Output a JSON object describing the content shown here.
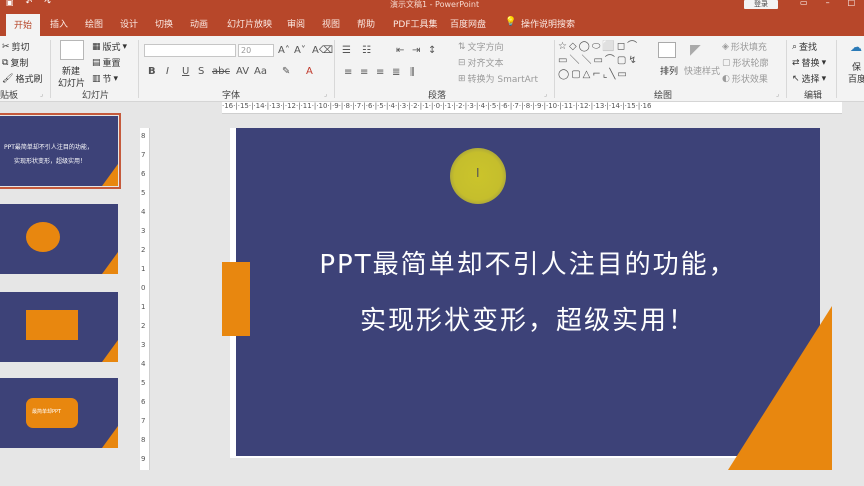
{
  "window": {
    "title": "演示文稿1  -  PowerPoint",
    "login": "登录"
  },
  "tabs": [
    {
      "label": "开始",
      "active": true
    },
    {
      "label": "插入"
    },
    {
      "label": "绘图"
    },
    {
      "label": "设计"
    },
    {
      "label": "切换"
    },
    {
      "label": "动画"
    },
    {
      "label": "幻灯片放映"
    },
    {
      "label": "审阅"
    },
    {
      "label": "视图"
    },
    {
      "label": "帮助"
    },
    {
      "label": "PDF工具集"
    },
    {
      "label": "百度网盘"
    },
    {
      "label": "操作说明搜索"
    }
  ],
  "ribbon": {
    "clipboard": {
      "cut": "剪切",
      "copy": "复制",
      "format_painter": "格式刷",
      "label": "贴板"
    },
    "slides": {
      "new_slide_1": "新建",
      "new_slide_2": "幻灯片",
      "layout": "版式",
      "reset": "重置",
      "section": "节",
      "label": "幻灯片"
    },
    "font": {
      "size": "20",
      "label": "字体"
    },
    "paragraph": {
      "text_direction": "文字方向",
      "align_text": "对齐文本",
      "smartart": "转换为 SmartArt",
      "label": "段落"
    },
    "drawing": {
      "arrange": "排列",
      "quick_styles": "快速样式",
      "shape_fill": "形状填充",
      "shape_outline": "形状轮廓",
      "shape_effects": "形状效果",
      "label": "绘图"
    },
    "editing": {
      "find": "查找",
      "replace": "替换",
      "select": "选择",
      "label": "编辑"
    },
    "save": {
      "label_1": "保",
      "label_2": "百度"
    }
  },
  "ruler_h": "·16·|·15·|·14·|·13·|·12·|·11·|·10·|·9·|·8·|·7·|·6·|·5·|·4·|·3·|·2·|·1·|·0·|·1·|·2·|·3·|·4·|·5·|·6·|·7·|·8·|·9·|·10·|·11·|·12·|·13·|·14·|·15·|·16",
  "ruler_v": [
    "8",
    "7",
    "6",
    "5",
    "4",
    "3",
    "2",
    "1",
    "0",
    "1",
    "2",
    "3",
    "4",
    "5",
    "6",
    "7",
    "8",
    "9"
  ],
  "thumbnails": {
    "t1_line1": "PPT最简单却不引人注目的功能，",
    "t1_line2": "实现形状变形，超级实用！",
    "t4_text": "最简单却PPT"
  },
  "slide": {
    "line1": "PPT最简单却不引人注目的功能，",
    "line2": "实现形状变形，超级实用！"
  },
  "colors": {
    "accent": "#b7472a",
    "slide_bg": "#3d4278",
    "orange": "#e8870f",
    "pointer": "#c5be2c"
  }
}
